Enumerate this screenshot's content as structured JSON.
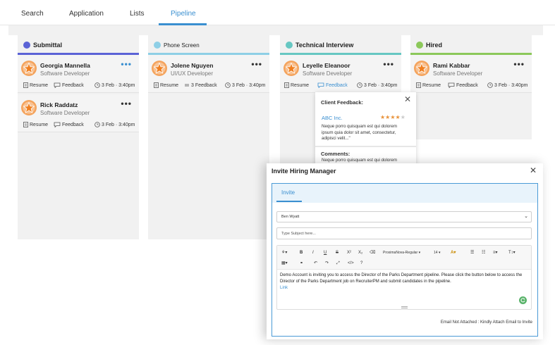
{
  "nav": {
    "tabs": [
      "Search",
      "Application",
      "Lists",
      "Pipeline"
    ],
    "active": "Pipeline"
  },
  "columns": [
    {
      "title": "Submittal",
      "color": "#5b63d6",
      "cards": [
        {
          "name": "Georgia Mannella",
          "role": "Software Developer",
          "resume": "Resume",
          "feedback": "Feedback",
          "date": "3 Feb · 3:40pm"
        },
        {
          "name": "Rick Raddatz",
          "role": "Software Developer",
          "resume": "Resume",
          "feedback": "Feedback",
          "date": "3 Feb · 3:40pm"
        }
      ]
    },
    {
      "title": "Phone Screen",
      "color": "#8ecfe6",
      "cards": [
        {
          "name": "Jolene Nguyen",
          "role": "UI/UX Developer",
          "resume": "Resume",
          "feedback": "3 Feedback",
          "date": "3 Feb · 3:40pm"
        }
      ]
    },
    {
      "title": "Technical Interview",
      "color": "#66c7c2",
      "cards": [
        {
          "name": "Leyelle Eleanoor",
          "role": "Software Developer",
          "resume": "Resume",
          "feedback": "Feedback",
          "date": "3 Feb · 3:40pm"
        }
      ]
    },
    {
      "title": "Hired",
      "color": "#8cc85a",
      "cards": [
        {
          "name": "Rami Kabbar",
          "role": "Software Developer",
          "resume": "Resume",
          "feedback": "Feedback",
          "date": "3 Feb · 3:40pm"
        }
      ]
    }
  ],
  "feedback_popover": {
    "title": "Client Feedback:",
    "company": "ABC Inc.",
    "rating": 4,
    "rating_max": 5,
    "text": "Neque porro quisquam est qui dolorem ipsum quia dolor sit amet, consectetur, adipisci velit...\"",
    "comments_label": "Comments:",
    "comments": "Neque porro quisquam est qui dolorem ipsum quia dolor sit amet"
  },
  "invite_dialog": {
    "title": "Invite Hiring Manager",
    "tab": "Invite",
    "recipient": "Ben Wyatt",
    "subject_placeholder": "Type Subject here...",
    "toolbar": {
      "font": "ProximaNova-Regular",
      "size": "14"
    },
    "body": "Demo Account is inviting you to access the Director of the Parks Department pipeline. Please click the button below to access the Director of the Parks Department job on RecruiterPM and submit candidates in the pipeline.",
    "link": "Link",
    "footer": "Email Not Attached : Kindly Attach Email to Invite"
  }
}
